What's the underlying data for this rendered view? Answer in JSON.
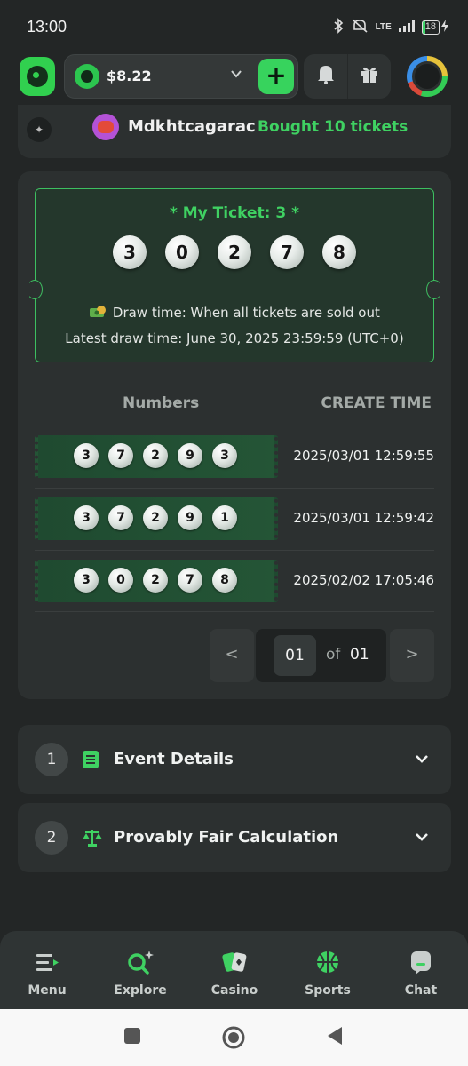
{
  "status_bar": {
    "time": "13:00",
    "network": "LTE",
    "battery": "18"
  },
  "header": {
    "balance": "$8.22",
    "add_label": "+"
  },
  "feed": {
    "username": "Mdkhtcagarac",
    "action": "Bought 10 tickets"
  },
  "my_ticket": {
    "title": "* My Ticket: 3 *",
    "numbers": [
      "3",
      "0",
      "2",
      "7",
      "8"
    ],
    "draw_time": "Draw time: When all tickets are sold out",
    "latest_draw_time": "Latest draw time: June 30, 2025 23:59:59 (UTC+0)"
  },
  "table": {
    "headers": [
      "Numbers",
      "CREATE TIME"
    ],
    "rows": [
      {
        "numbers": [
          "3",
          "7",
          "2",
          "9",
          "3"
        ],
        "time": "2025/03/01 12:59:55"
      },
      {
        "numbers": [
          "3",
          "7",
          "2",
          "9",
          "1"
        ],
        "time": "2025/03/01 12:59:42"
      },
      {
        "numbers": [
          "3",
          "0",
          "2",
          "7",
          "8"
        ],
        "time": "2025/02/02 17:05:46"
      }
    ]
  },
  "pagination": {
    "prev": "<",
    "current": "01",
    "of": "of",
    "total": "01",
    "next": ">"
  },
  "accordions": [
    {
      "number": "1",
      "title": "Event Details",
      "icon": "list-icon"
    },
    {
      "number": "2",
      "title": "Provably Fair Calculation",
      "icon": "scale-icon"
    }
  ],
  "bottom_nav": [
    {
      "label": "Menu",
      "icon": "menu-icon"
    },
    {
      "label": "Explore",
      "icon": "search-sparkle-icon"
    },
    {
      "label": "Casino",
      "icon": "cards-icon"
    },
    {
      "label": "Sports",
      "icon": "basketball-icon"
    },
    {
      "label": "Chat",
      "icon": "chat-icon"
    }
  ],
  "colors": {
    "background": "#232626",
    "card": "#2c3030",
    "accent_green": "#3fd162",
    "ticket_bg": "#24372c"
  }
}
